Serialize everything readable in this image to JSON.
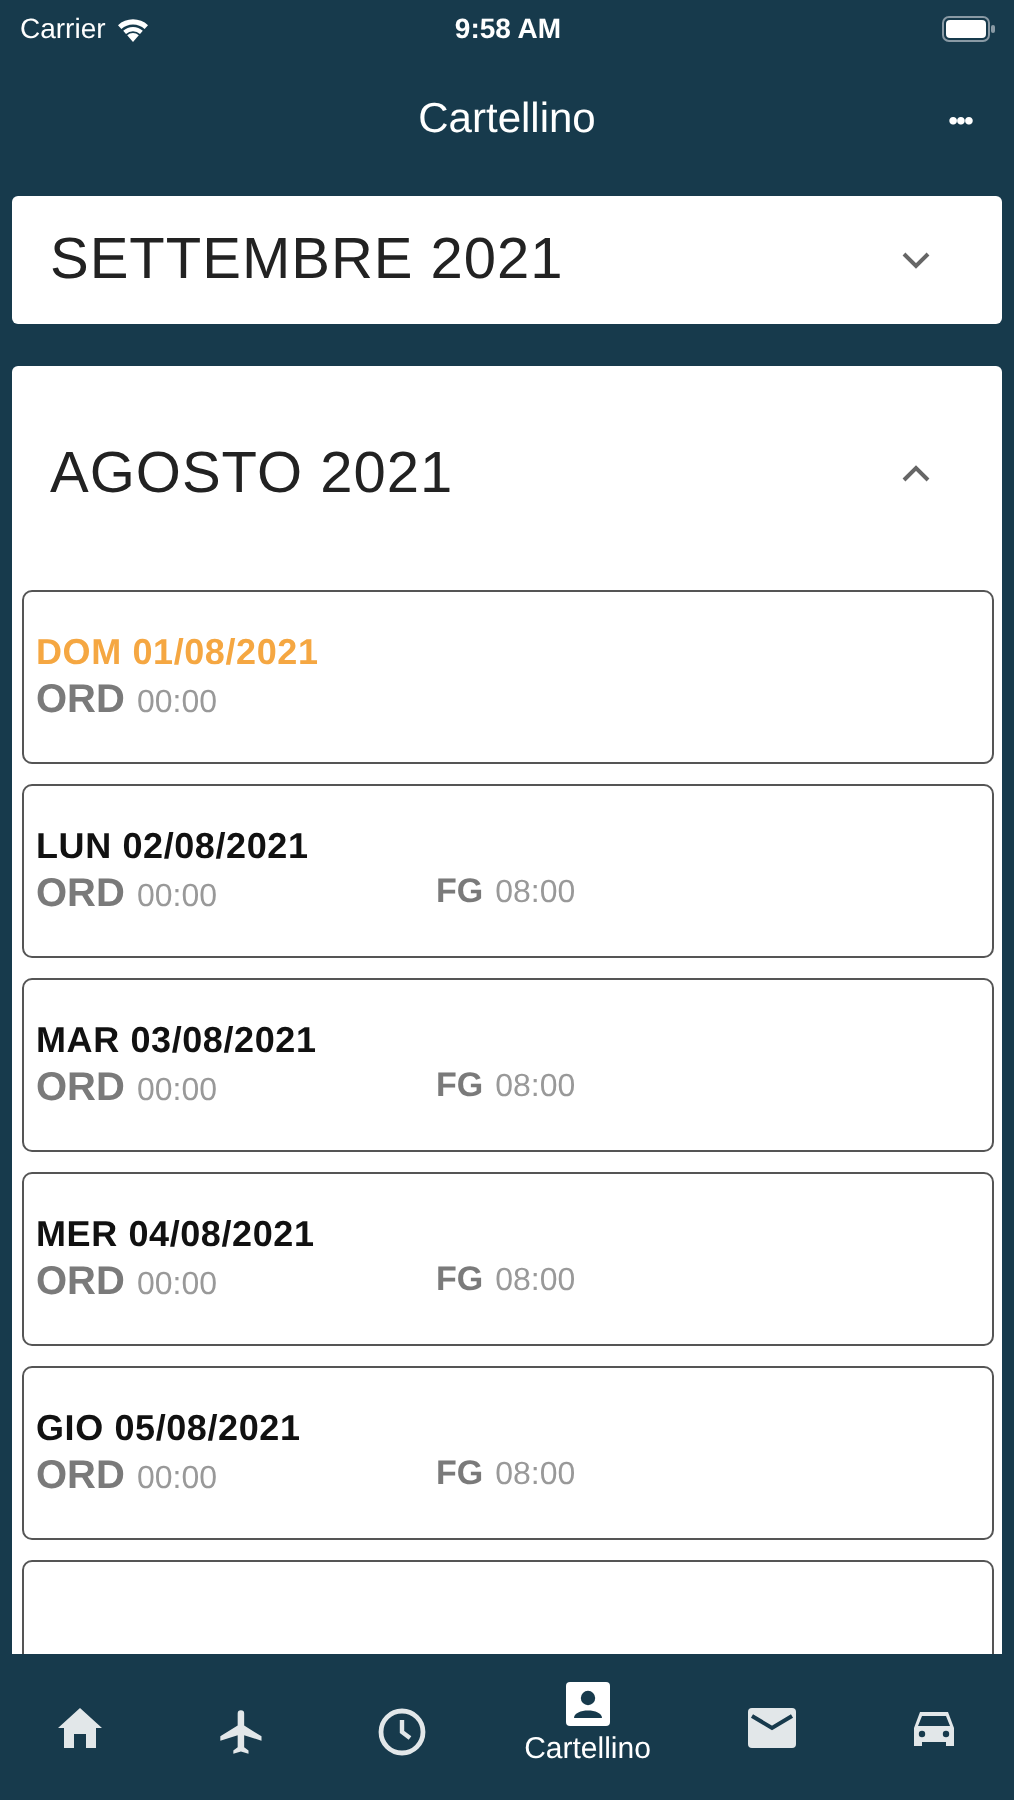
{
  "status_bar": {
    "carrier": "Carrier",
    "time": "9:58 AM"
  },
  "nav_bar": {
    "title": "Cartellino",
    "more": "•••"
  },
  "months": [
    {
      "title": "SETTEMBRE 2021",
      "expanded": false
    },
    {
      "title": "AGOSTO 2021",
      "expanded": true,
      "days": [
        {
          "date": "DOM 01/08/2021",
          "holiday": true,
          "entries": [
            {
              "code": "ORD",
              "time": "00:00"
            }
          ]
        },
        {
          "date": "LUN 02/08/2021",
          "holiday": false,
          "entries": [
            {
              "code": "ORD",
              "time": "00:00"
            },
            {
              "code": "FG",
              "time": "08:00"
            }
          ]
        },
        {
          "date": "MAR 03/08/2021",
          "holiday": false,
          "entries": [
            {
              "code": "ORD",
              "time": "00:00"
            },
            {
              "code": "FG",
              "time": "08:00"
            }
          ]
        },
        {
          "date": "MER 04/08/2021",
          "holiday": false,
          "entries": [
            {
              "code": "ORD",
              "time": "00:00"
            },
            {
              "code": "FG",
              "time": "08:00"
            }
          ]
        },
        {
          "date": "GIO 05/08/2021",
          "holiday": false,
          "entries": [
            {
              "code": "ORD",
              "time": "00:00"
            },
            {
              "code": "FG",
              "time": "08:00"
            }
          ]
        }
      ]
    }
  ],
  "tab_bar": [
    {
      "kind": "home",
      "selected": false
    },
    {
      "kind": "plane",
      "selected": false
    },
    {
      "kind": "clock",
      "selected": false
    },
    {
      "kind": "badge",
      "label": "Cartellino",
      "selected": true
    },
    {
      "kind": "mail",
      "selected": false
    },
    {
      "kind": "car",
      "selected": false
    }
  ]
}
